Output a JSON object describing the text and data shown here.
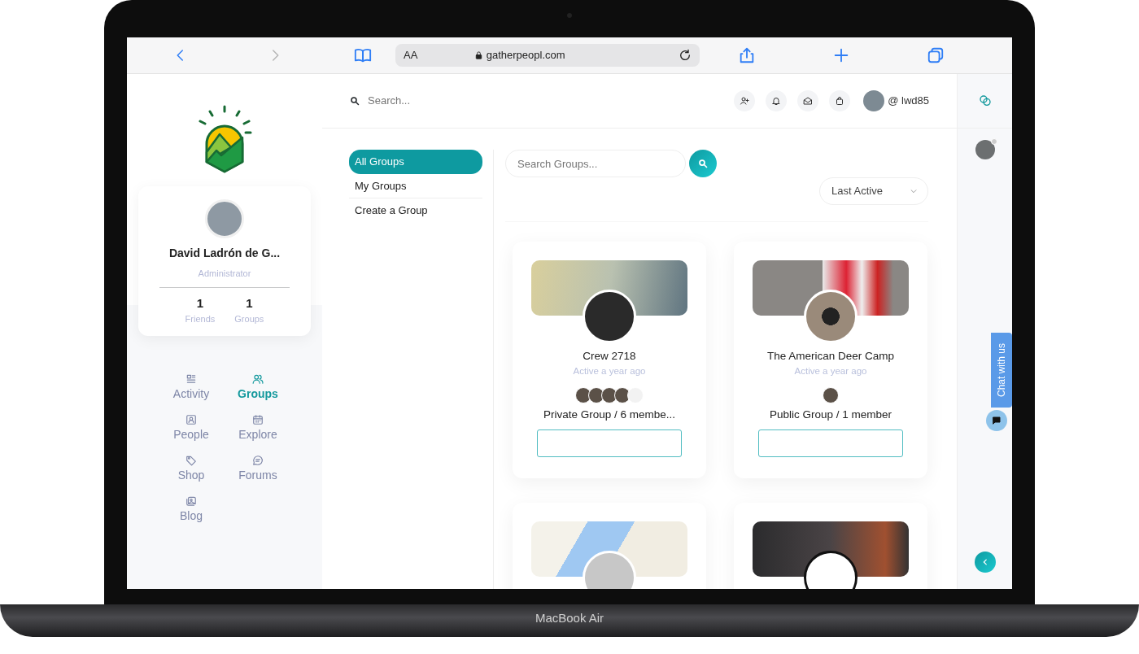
{
  "browser": {
    "text_size": "AA",
    "url": "gatherpeopl.com"
  },
  "sidebar": {
    "profile": {
      "name": "David Ladrón de G...",
      "role": "Administrator",
      "stats": [
        {
          "value": "1",
          "label": "Friends"
        },
        {
          "value": "1",
          "label": "Groups"
        }
      ]
    },
    "nav": [
      {
        "kind": "activity",
        "label": "Activity",
        "selected": false
      },
      {
        "kind": "groups",
        "label": "Groups",
        "selected": true
      },
      {
        "kind": "people",
        "label": "People",
        "selected": false
      },
      {
        "kind": "explore",
        "label": "Explore",
        "selected": false
      },
      {
        "kind": "shop",
        "label": "Shop",
        "selected": false
      },
      {
        "kind": "forums",
        "label": "Forums",
        "selected": false
      },
      {
        "kind": "blog",
        "label": "Blog",
        "selected": false
      }
    ]
  },
  "header": {
    "search": {
      "placeholder": "Search..."
    },
    "username": "@ lwd85"
  },
  "group_nav": [
    {
      "label": "All Groups",
      "selected": true
    },
    {
      "label": "My Groups",
      "selected": false
    },
    {
      "label": "Create a Group",
      "selected": false
    }
  ],
  "group_search": {
    "placeholder": "Search Groups..."
  },
  "sort": {
    "value": "Last Active"
  },
  "groups": [
    {
      "cover": {
        "kind": "forest"
      },
      "avatar": {
        "kind": "dark"
      },
      "name": "Crew 2718",
      "activity": "Active a year ago",
      "members": [
        {
          "kind": "photo"
        },
        {
          "kind": "photo"
        },
        {
          "kind": "photo"
        },
        {
          "kind": "photo"
        },
        {
          "kind": "logo"
        }
      ],
      "status": "Private Group / 6 membe..."
    },
    {
      "cover": {
        "kind": "flag"
      },
      "avatar": {
        "kind": "photo"
      },
      "name": "The American Deer Camp",
      "activity": "Active a year ago",
      "members": [
        {
          "kind": "photo"
        }
      ],
      "status": "Public Group / 1 member"
    },
    {
      "cover": {
        "kind": "map"
      },
      "avatar": {
        "kind": "default"
      }
    },
    {
      "cover": {
        "kind": "crowd"
      },
      "avatar": {
        "kind": "logo"
      }
    }
  ],
  "chat_widget": {
    "label": "Chat with us"
  },
  "laptop": {
    "model": "MacBook Air"
  }
}
